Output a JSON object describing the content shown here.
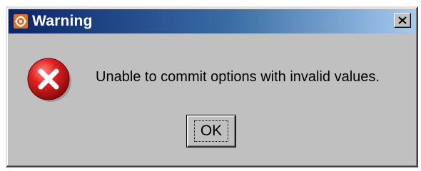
{
  "window": {
    "title": "Warning",
    "app_icon": "java-cup-icon",
    "close_label": "×"
  },
  "message": {
    "icon": "error-icon",
    "text": "Unable to commit options with invalid values."
  },
  "buttons": {
    "ok_label": "OK"
  },
  "colors": {
    "titlebar_start": "#0a246a",
    "titlebar_end": "#a6caf0",
    "dialog_face": "#c0c0c0",
    "error_red": "#d01818"
  }
}
